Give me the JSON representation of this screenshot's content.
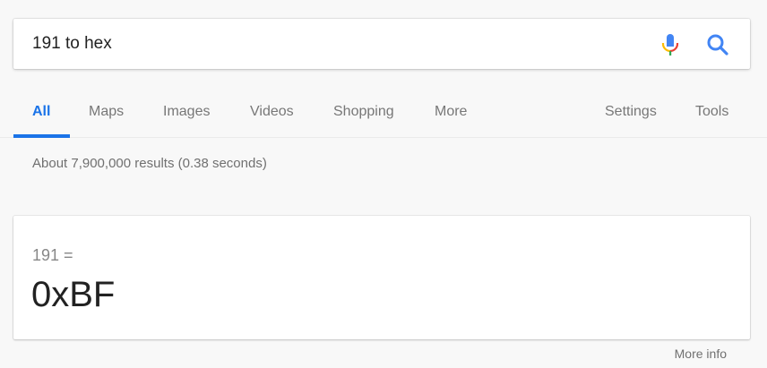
{
  "search": {
    "query": "191 to hex",
    "mic_icon": "microphone-icon",
    "search_icon": "magnifier-icon"
  },
  "tabs": {
    "items": [
      {
        "label": "All",
        "active": true
      },
      {
        "label": "Maps",
        "active": false
      },
      {
        "label": "Images",
        "active": false
      },
      {
        "label": "Videos",
        "active": false
      },
      {
        "label": "Shopping",
        "active": false
      },
      {
        "label": "More",
        "active": false
      }
    ],
    "settings_label": "Settings",
    "tools_label": "Tools"
  },
  "results": {
    "stats": "About 7,900,000 results (0.38 seconds)"
  },
  "answer": {
    "question": "191 =",
    "value": "0xBF",
    "more_info": "More info"
  },
  "colors": {
    "accent": "#1a73e8",
    "background": "#f8f8f8",
    "card": "#ffffff"
  }
}
